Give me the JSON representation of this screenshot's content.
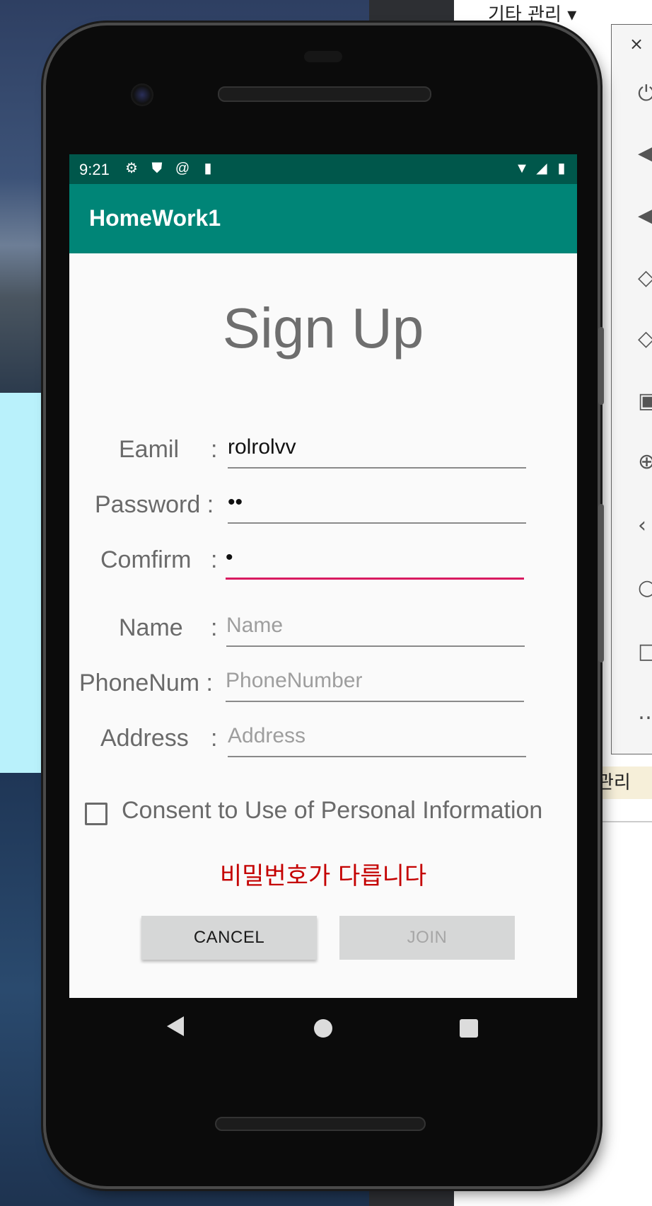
{
  "desktop": {
    "menu_label": "기타 관리 ▾",
    "side_close": "×",
    "mgmt_label": "관리"
  },
  "status_bar": {
    "time": "9:21",
    "icons": [
      "gear-icon",
      "shield-icon",
      "sync-icon",
      "sd-card-icon",
      "wifi-icon",
      "signal-icon",
      "battery-icon"
    ]
  },
  "app_bar": {
    "title": "HomeWork1"
  },
  "form": {
    "title": "Sign Up",
    "rows": [
      {
        "label": "Eamil",
        "value": "rolrolvv",
        "placeholder": ""
      },
      {
        "label": "Password :",
        "value": "••",
        "placeholder": ""
      },
      {
        "label": "Comfirm",
        "value": "•",
        "placeholder": ""
      },
      {
        "label": "Name",
        "value": "",
        "placeholder": "Name"
      },
      {
        "label": "PhoneNum :",
        "value": "",
        "placeholder": "PhoneNumber"
      },
      {
        "label": "Address",
        "value": "",
        "placeholder": "Address"
      }
    ],
    "colon": ":",
    "consent_label": "Consent to Use of Personal Information",
    "error_message": "비밀번호가 다릅니다",
    "cancel_label": "CANCEL",
    "join_label": "JOIN"
  },
  "colors": {
    "status_bar": "#00574b",
    "app_bar": "#008577",
    "focus_underline": "#d81b60",
    "error": "#c40000"
  }
}
